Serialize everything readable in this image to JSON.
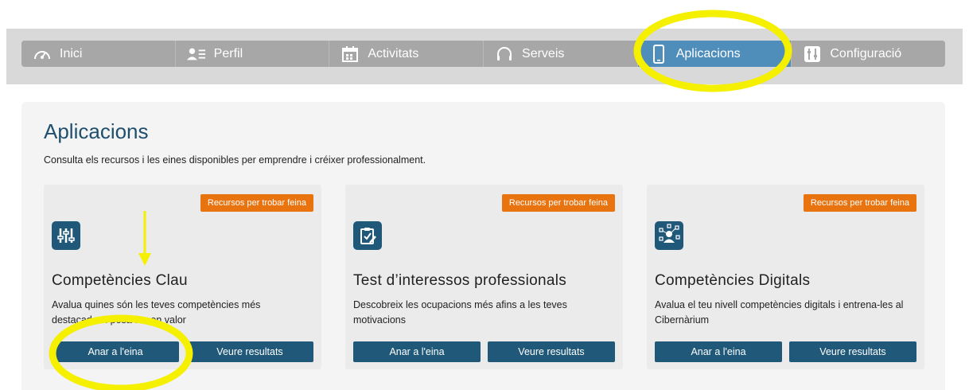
{
  "nav": {
    "items": [
      {
        "label": "Inici",
        "icon": "gauge-icon"
      },
      {
        "label": "Perfil",
        "icon": "profile-icon"
      },
      {
        "label": "Activitats",
        "icon": "calendar-icon"
      },
      {
        "label": "Serveis",
        "icon": "headset-icon"
      },
      {
        "label": "Aplicacions",
        "icon": "phone-icon",
        "active": true
      },
      {
        "label": "Configuració",
        "icon": "settings-sliders-icon"
      }
    ]
  },
  "page": {
    "title": "Aplicacions",
    "subtitle": "Consulta els recursos i les eines disponibles per emprendre i créixer professionalment."
  },
  "cards": [
    {
      "tag": "Recursos per trobar feina",
      "title": "Competències Clau",
      "description": "Avalua quines són les teves competències més destacades i posa-les en valor",
      "btn_primary": "Anar a l'eina",
      "btn_secondary": "Veure resultats",
      "icon": "sliders-icon"
    },
    {
      "tag": "Recursos per trobar feina",
      "title": "Test d’interessos professionals",
      "description": "Descobreix les ocupacions més afins a les teves motivacions",
      "btn_primary": "Anar a l'eina",
      "btn_secondary": "Veure resultats",
      "icon": "clipboard-edit-icon"
    },
    {
      "tag": "Recursos per trobar feina",
      "title": "Competències Digitals",
      "description": "Avalua el teu nivell competències digitals i entrena-les al Cibernàrium",
      "btn_primary": "Anar a l'eina",
      "btn_secondary": "Veure resultats",
      "icon": "user-network-icon"
    }
  ],
  "colors": {
    "accent": "#4f8dba",
    "dark_blue": "#1f5879",
    "tag_orange": "#e8730f",
    "highlight_yellow": "#f5ef00"
  }
}
